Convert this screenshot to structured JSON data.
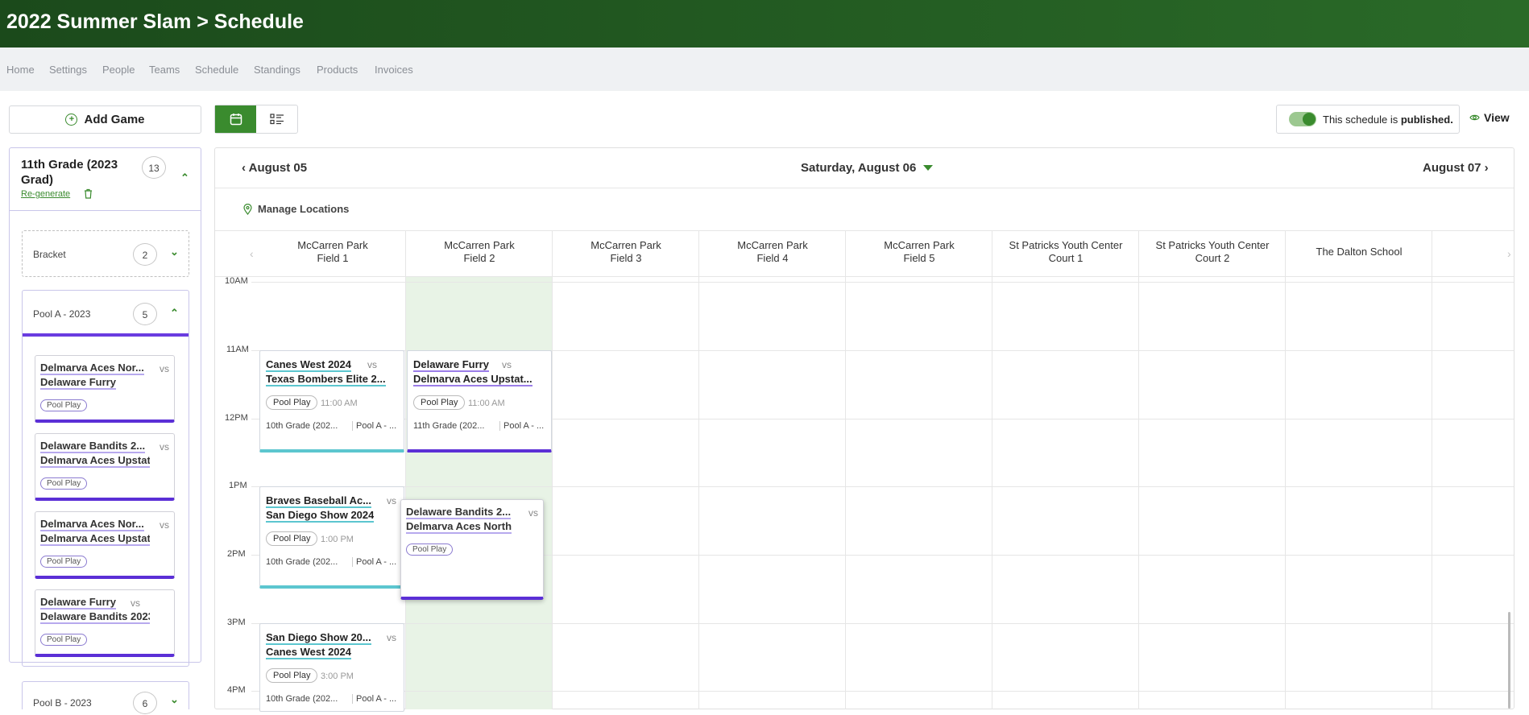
{
  "header": {
    "breadcrumb": "2022 Summer Slam > Schedule"
  },
  "nav": {
    "items": [
      "Home",
      "Settings",
      "People",
      "Teams",
      "Schedule",
      "Standings",
      "Products",
      "Invoices"
    ]
  },
  "toolbar": {
    "add_game": "Add Game",
    "publish_text": "This schedule is ",
    "publish_strong": "published.",
    "view": "View"
  },
  "sidebar": {
    "division_title": "11th Grade (2023 Grad)",
    "division_count": "13",
    "regenerate": "Re-generate",
    "bracket_label": "Bracket",
    "bracket_count": "2",
    "pool_a_label": "Pool A - 2023",
    "pool_a_count": "5",
    "pool_b_label": "Pool B - 2023",
    "pool_b_count": "6",
    "vs": "vs",
    "tag": "Pool Play",
    "cards": [
      {
        "team1": "Delmarva Aces Nor...",
        "team2": "Delaware Furry"
      },
      {
        "team1": "Delaware Bandits 2...",
        "team2": "Delmarva Aces Upstat..."
      },
      {
        "team1": "Delmarva Aces Nor...",
        "team2": "Delmarva Aces Upstat..."
      },
      {
        "team1": "Delaware Furry",
        "team2": "Delaware Bandits 2023"
      }
    ]
  },
  "calendar": {
    "prev": "August 05",
    "current": "Saturday, August 06",
    "next": "August 07",
    "manage": "Manage Locations",
    "columns": [
      {
        "l1": "McCarren Park",
        "l2": "Field 1"
      },
      {
        "l1": "McCarren Park",
        "l2": "Field 2"
      },
      {
        "l1": "McCarren Park",
        "l2": "Field 3"
      },
      {
        "l1": "McCarren Park",
        "l2": "Field 4"
      },
      {
        "l1": "McCarren Park",
        "l2": "Field 5"
      },
      {
        "l1": "St Patricks Youth Center",
        "l2": "Court 1"
      },
      {
        "l1": "St Patricks Youth Center",
        "l2": "Court 2"
      },
      {
        "l1": "The Dalton School",
        "l2": ""
      }
    ],
    "times": [
      "10AM",
      "11AM",
      "12PM",
      "1PM",
      "2PM",
      "3PM",
      "4PM"
    ],
    "games": [
      {
        "team1": "Canes West 2024",
        "team2": "Texas Bombers Elite 2...",
        "vs": "vs",
        "tag": "Pool Play",
        "time": "11:00 AM",
        "division": "10th Grade (202...",
        "pool": "Pool A - ..."
      },
      {
        "team1": "Delaware Furry",
        "team2": "Delmarva Aces Upstat...",
        "vs": "vs",
        "tag": "Pool Play",
        "time": "11:00 AM",
        "division": "11th Grade (202...",
        "pool": "Pool A - ..."
      },
      {
        "team1": "Braves Baseball Ac...",
        "team2": "San Diego Show 2024",
        "vs": "vs",
        "tag": "Pool Play",
        "time": "1:00 PM",
        "division": "10th Grade (202...",
        "pool": "Pool A - ..."
      },
      {
        "team1": "San Diego Show 20...",
        "team2": "Canes West 2024",
        "vs": "vs",
        "tag": "Pool Play",
        "time": "3:00 PM",
        "division": "10th Grade (202...",
        "pool": "Pool A - ..."
      }
    ],
    "dragging": {
      "team1": "Delaware Bandits 2...",
      "team2": "Delmarva Aces North",
      "vs": "vs",
      "tag": "Pool Play"
    }
  }
}
